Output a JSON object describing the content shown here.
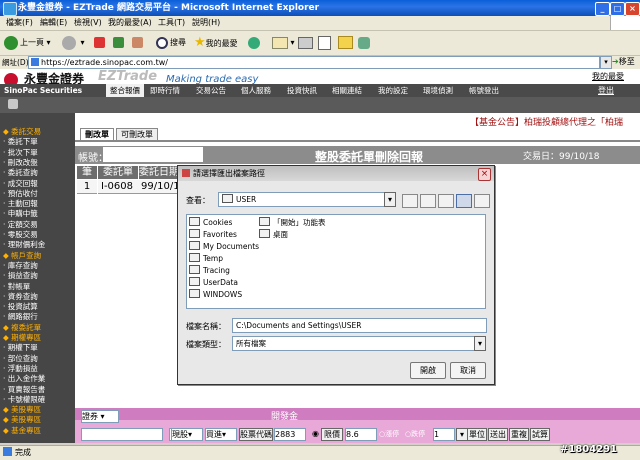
{
  "window": {
    "title": "永豐金證券 - EZTrade 網路交易平台 - Microsoft Internet Explorer"
  },
  "menubar": [
    "檔案(F)",
    "編輯(E)",
    "檢視(V)",
    "我的最愛(A)",
    "工具(T)",
    "說明(H)"
  ],
  "toolbar": {
    "back": "上一頁",
    "search": "搜尋",
    "favorites": "我的最愛"
  },
  "address": {
    "label": "網址(D)",
    "url": "https://eztrade.sinopac.com.tw/",
    "go": "移至"
  },
  "site": {
    "brand_cn": "永豐金證券",
    "brand_en": "SinoPac Securities",
    "ez_logo": "EZTrade",
    "slogan": "Making trade easy",
    "my_favorites": "我的最愛",
    "logout": "登出",
    "nav": [
      "整合報價",
      "即時行情",
      "交易公告",
      "個人服務",
      "投資快訊",
      "相關連結",
      "我的設定",
      "環境偵測",
      "帳號登出"
    ]
  },
  "sidebar": {
    "items": [
      {
        "label": "委託交易",
        "section": true
      },
      {
        "label": "委託下單"
      },
      {
        "label": "批次下單"
      },
      {
        "label": "刪改改盤"
      },
      {
        "label": "委託查詢"
      },
      {
        "label": "成交回報"
      },
      {
        "label": "預估收付"
      },
      {
        "label": "主動回報"
      },
      {
        "label": "申購中籤"
      },
      {
        "label": "定額交易"
      },
      {
        "label": "零股交易"
      },
      {
        "label": "理財價利金"
      },
      {
        "label": "帳戶查詢",
        "section": true
      },
      {
        "label": "庫存查詢"
      },
      {
        "label": "損益查詢"
      },
      {
        "label": "對帳單"
      },
      {
        "label": "資券查詢"
      },
      {
        "label": "投資試算"
      },
      {
        "label": "網路銀行"
      },
      {
        "label": "複委託單",
        "section": true
      },
      {
        "label": "期權專區",
        "section": true
      },
      {
        "label": "期權下單"
      },
      {
        "label": "部位查詢"
      },
      {
        "label": "浮動損益"
      },
      {
        "label": "出入金作業"
      },
      {
        "label": "買賣報告書"
      },
      {
        "label": "卡號權限確"
      },
      {
        "label": "美股專區",
        "section": true
      },
      {
        "label": "美股專區",
        "section": true
      },
      {
        "label": "基金專區",
        "section": true
      }
    ]
  },
  "main": {
    "announcement": "【基金公告】柏瑞投顧總代理之「柏瑞",
    "tabs": [
      "刪改單",
      "可刪改單"
    ],
    "page_title": "整股委託單刪除回報",
    "account_label": "帳號：",
    "trade_date": "交易日：99/10/18",
    "status_header": "狀態",
    "table": {
      "headers": [
        "筆",
        "委託單",
        "委託日期"
      ],
      "rows": [
        [
          "1",
          "I-0608",
          "99/10/1"
        ]
      ]
    }
  },
  "order_panel": {
    "title": "開發金",
    "type": "證券",
    "market": "現股",
    "side": "買進",
    "stock_label": "股票代碼",
    "stock_code": "2883",
    "price_label": "限價",
    "price": "8.6",
    "rise_label": "漲停",
    "fall_label": "跌停",
    "qty": "1",
    "unit_label": "單位",
    "send": "送出",
    "reset": "重複",
    "trial": "試算"
  },
  "dialog": {
    "title": "請選擇匯出檔案路徑",
    "lookin_label": "查看：",
    "lookin_value": "USER",
    "files_col1": [
      "Cookies",
      "Favorites",
      "My Documents",
      "Temp",
      "Tracing",
      "UserData",
      "WINDOWS"
    ],
    "files_col2": [
      "「開始」功能表",
      "桌面"
    ],
    "filename_label": "檔案名稱：",
    "filename_value": "C:\\Documents and Settings\\USER",
    "filetype_label": "檔案類型：",
    "filetype_value": "所有檔案",
    "open_button": "開啟",
    "cancel_button": "取消"
  },
  "statusbar": {
    "text": "完成"
  },
  "watermark": "#1804291"
}
